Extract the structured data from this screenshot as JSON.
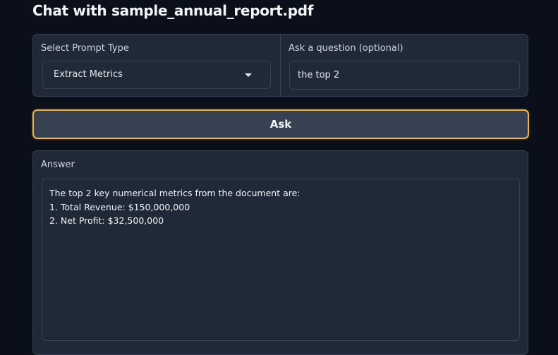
{
  "header": {
    "title": "Chat with sample_annual_report.pdf"
  },
  "prompt_type": {
    "label": "Select Prompt Type",
    "selected": "Extract Metrics"
  },
  "question": {
    "label": "Ask a question (optional)",
    "value": "the top 2"
  },
  "ask_button": {
    "label": "Ask"
  },
  "answer": {
    "label": "Answer",
    "lines": [
      "The top 2 key numerical metrics from the document are:",
      "1. Total Revenue: $150,000,000",
      "2. Net Profit: $32,500,000"
    ]
  },
  "colors": {
    "background": "#0b0f19",
    "panel": "#1f2937",
    "border": "#374151",
    "accent_border": "#f3b541",
    "button": "#374151"
  },
  "icons": {
    "dropdown": "chevron-down-icon"
  }
}
